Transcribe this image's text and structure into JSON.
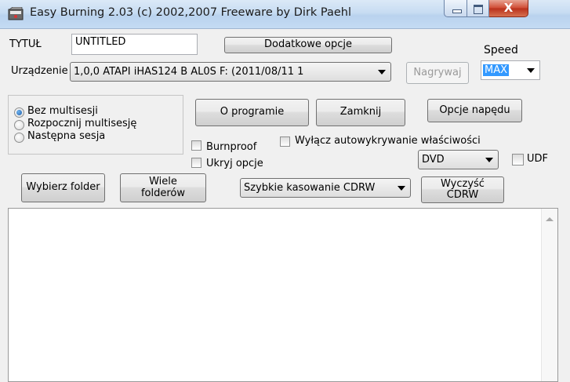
{
  "window": {
    "title": "Easy Burning 2.03 (c) 2002,2007 Freeware by Dirk Paehl",
    "minimize_glyph": "",
    "close_glyph": "X"
  },
  "title_field": {
    "label": "TYTUŁ",
    "value": "UNTITLED"
  },
  "device": {
    "label": "Urządzenie",
    "selected": "1,0,0 ATAPI   iHAS124   B     AL0S F: (2011/08/11 1"
  },
  "speed": {
    "label": "Speed",
    "selected": "MAX"
  },
  "buttons": {
    "extra_options": "Dodatkowe opcje",
    "burn": "Nagrywaj",
    "about": "O programie",
    "close": "Zamknij",
    "drive_options": "Opcje napędu",
    "choose_folder": "Wybierz folder",
    "many_folders": "Wiele folderów",
    "erase_cdrw": "Wyczyść CDRW"
  },
  "session": {
    "options": [
      {
        "label": "Bez multisesji",
        "checked": true
      },
      {
        "label": "Rozpocznij multisesję",
        "checked": false
      },
      {
        "label": "Następna sesja",
        "checked": false
      }
    ]
  },
  "checkboxes": {
    "burnproof": "Burnproof",
    "hide_options": "Ukryj opcje",
    "disable_autodetect": "Wyłącz autowykrywanie właściwości",
    "udf": "UDF"
  },
  "media": {
    "selected": "DVD"
  },
  "erase_mode": {
    "selected": "Szybkie kasowanie CDRW"
  }
}
